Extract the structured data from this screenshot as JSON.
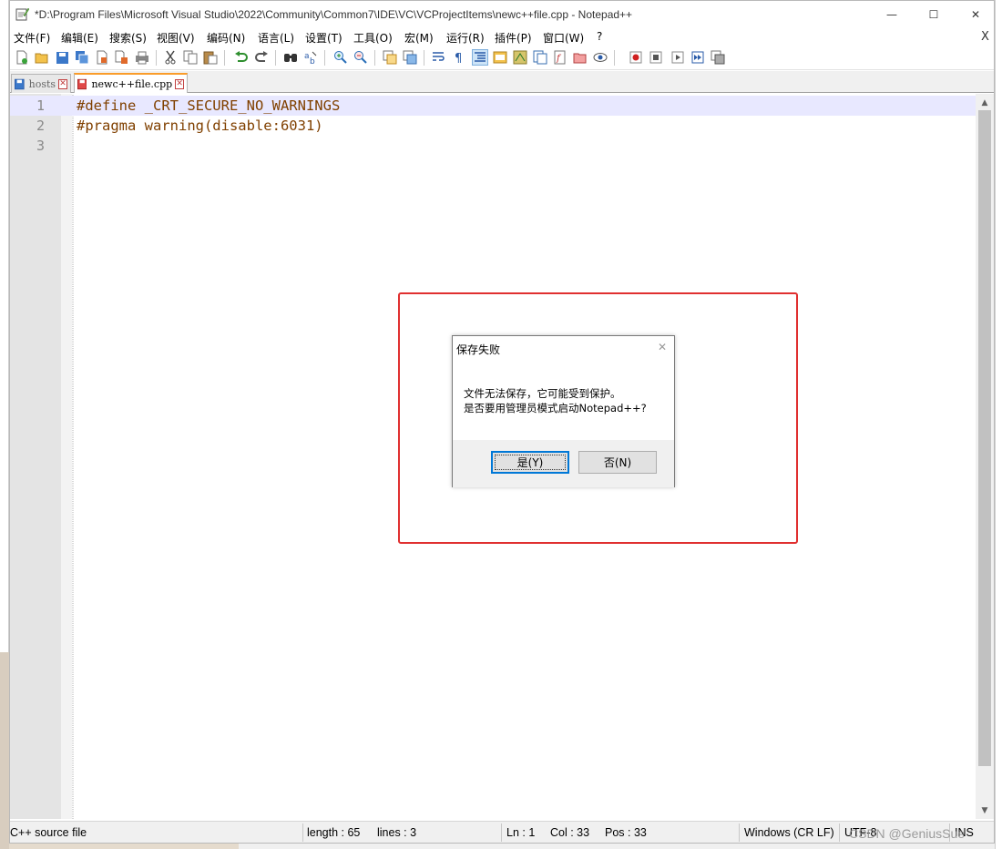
{
  "window": {
    "title": "*D:\\Program Files\\Microsoft Visual Studio\\2022\\Community\\Common7\\IDE\\VC\\VCProjectItems\\newc++file.cpp - Notepad++",
    "minimize_glyph": "—",
    "maximize_glyph": "☐",
    "close_glyph": "✕"
  },
  "menu": {
    "items": [
      "文件(F)",
      "编辑(E)",
      "搜索(S)",
      "视图(V)",
      "编码(N)",
      "语言(L)",
      "设置(T)",
      "工具(O)",
      "宏(M)",
      "运行(R)",
      "插件(P)",
      "窗口(W)",
      "?"
    ],
    "close_doc": "X"
  },
  "toolbar": {
    "icons": [
      "new-icon",
      "open-icon",
      "save-icon",
      "save-all-icon",
      "close-icon",
      "close-all-icon",
      "print-icon",
      "cut-icon",
      "copy-icon",
      "paste-icon",
      "undo-icon",
      "redo-icon",
      "find-icon",
      "replace-icon",
      "zoom-in-icon",
      "zoom-out-icon",
      "sync-v-icon",
      "sync-h-icon",
      "word-wrap-icon",
      "show-all-chars-icon",
      "indent-guide-icon",
      "doc-map-icon",
      "function-list-icon",
      "folder-workspace-icon",
      "monitoring-icon",
      "doc-list-icon",
      "eye-icon",
      "record-macro-icon",
      "stop-macro-icon",
      "play-macro-icon",
      "run-macro-multiple-icon",
      "save-macro-icon"
    ]
  },
  "tabs": [
    {
      "label": "hosts",
      "active": false
    },
    {
      "label": "newc++file.cpp",
      "active": true
    }
  ],
  "editor": {
    "lines": [
      {
        "num": "1",
        "text": "#define _CRT_SECURE_NO_WARNINGS"
      },
      {
        "num": "2",
        "text": "#pragma warning(disable:6031)"
      },
      {
        "num": "3",
        "text": ""
      }
    ],
    "current_line": 1,
    "text_color": "#804000"
  },
  "dialog": {
    "title": "保存失败",
    "close_glyph": "✕",
    "message_line1": "文件无法保存，它可能受到保护。",
    "message_line2": "是否要用管理员模式启动Notepad++?",
    "yes_label": "是(Y)",
    "no_label": "否(N)"
  },
  "status": {
    "file_type": "C++ source file",
    "length": "length : 65",
    "lines": "lines : 3",
    "ln": "Ln : 1",
    "col": "Col : 33",
    "pos": "Pos : 33",
    "eol": "Windows (CR LF)",
    "encoding": "UTF-8",
    "mode": "INS"
  },
  "watermark": "CSDN @GeniusSue",
  "colors": {
    "highlight_box": "#e03030",
    "active_tab_accent": "#fa9c2a",
    "current_line_bg": "#e8e8ff",
    "dialog_default_border": "#0078d7"
  }
}
